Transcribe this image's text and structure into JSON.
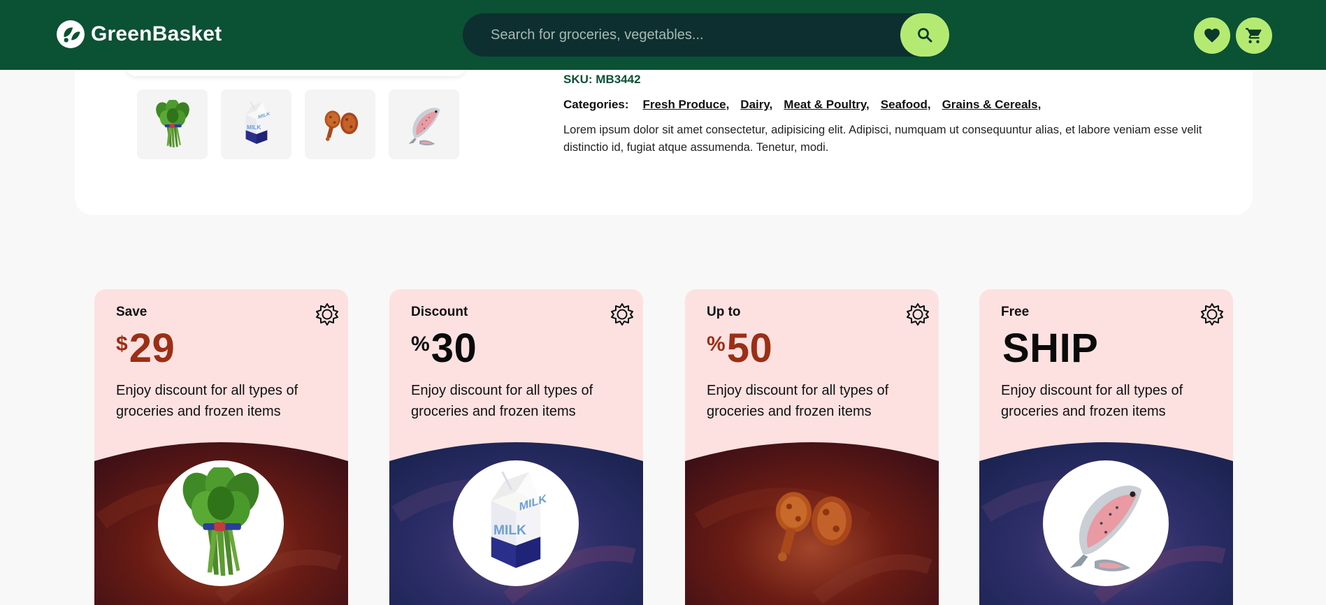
{
  "header": {
    "brand": "GreenBasket",
    "search_placeholder": "Search for groceries, vegetables...",
    "search_icon": "search-icon",
    "wishlist_icon": "heart-icon",
    "cart_icon": "cart-icon"
  },
  "product": {
    "sku_label": "SKU: MB3442",
    "categories_label": "Categories:",
    "categories": [
      "Fresh Produce,",
      "Dairy,",
      "Meat & Poultry,",
      "Seafood,",
      "Grains & Cereals,"
    ],
    "description": "Lorem ipsum dolor sit amet consectetur, adipisicing elit. Adipisci, numquam ut consequuntur alias, et labore veniam esse velit distinctio id, fugiat atque assumenda. Tenetur, modi.",
    "thumbnails": [
      "spinach",
      "milk",
      "fried-chicken",
      "trout"
    ]
  },
  "offers": [
    {
      "pre": "Save",
      "symbol": "$",
      "value": "29",
      "desc": "Enjoy discount for all types of groceries and frozen items",
      "image": "spinach",
      "accent": "#9a2f15"
    },
    {
      "pre": "Discount",
      "symbol": "%",
      "value": "30",
      "desc": "Enjoy discount for all types of groceries and frozen items",
      "image": "milk",
      "accent": "#0a0a0a"
    },
    {
      "pre": "Up to",
      "symbol": "%",
      "value": "50",
      "desc": "Enjoy discount for all types of groceries and frozen items",
      "image": "fried-chicken",
      "accent": "#9a2f15"
    },
    {
      "pre": "Free",
      "symbol": "",
      "value": "SHIP",
      "desc": "Enjoy discount for all types of groceries and frozen items",
      "image": "trout",
      "accent": "#0a0a0a"
    }
  ],
  "colors": {
    "header_bg": "#0b5134",
    "accent_green": "#b5ea72",
    "card_bg": "#fde1e1",
    "offer_red": "#9a2f15"
  }
}
